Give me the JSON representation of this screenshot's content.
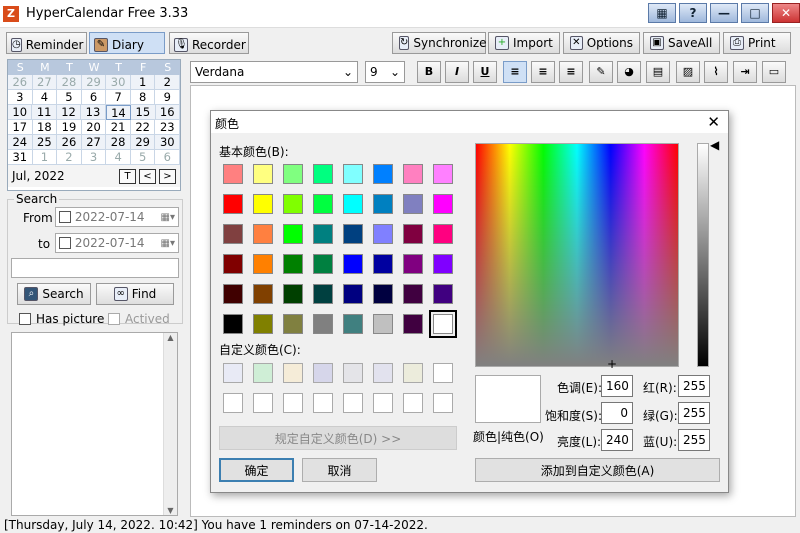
{
  "app": {
    "title": "HyperCalendar Free 3.33"
  },
  "tabs": [
    {
      "label": "Reminder"
    },
    {
      "label": "Diary"
    },
    {
      "label": "Recorder"
    }
  ],
  "toolbar": {
    "synchronize": "Synchronize",
    "import": "Import",
    "options": "Options",
    "saveall": "SaveAll",
    "print": "Print"
  },
  "calendar": {
    "weekdays": [
      "S",
      "M",
      "T",
      "W",
      "T",
      "F",
      "S"
    ],
    "weeks": [
      [
        "26",
        "27",
        "28",
        "29",
        "30",
        "1",
        "2"
      ],
      [
        "3",
        "4",
        "5",
        "6",
        "7",
        "8",
        "9"
      ],
      [
        "10",
        "11",
        "12",
        "13",
        "14",
        "15",
        "16"
      ],
      [
        "17",
        "18",
        "19",
        "20",
        "21",
        "22",
        "23"
      ],
      [
        "24",
        "25",
        "26",
        "27",
        "28",
        "29",
        "30"
      ],
      [
        "31",
        "1",
        "2",
        "3",
        "4",
        "5",
        "6"
      ]
    ],
    "selected": "14",
    "month_label": "Jul, 2022",
    "today_btn": "T",
    "prev": "<",
    "next": ">"
  },
  "search": {
    "group_label": "Search",
    "from_label": "From",
    "from_value": "2022-07-14",
    "to_label": "to",
    "to_value": "2022-07-14",
    "text_value": "",
    "search_btn": "Search",
    "find_btn": "Find",
    "has_picture": "Has picture",
    "actived": "Actived"
  },
  "editor": {
    "font": "Verdana",
    "size": "9"
  },
  "status": "[Thursday, July 14, 2022. 10:42] You have 1 reminders on 07-14-2022.",
  "dialog": {
    "title": "颜色",
    "basic_label": "基本颜色(B):",
    "custom_label": "自定义颜色(C):",
    "define_btn": "规定自定义颜色(D) >>",
    "ok": "确定",
    "cancel": "取消",
    "color_solid": "颜色|纯色(O)",
    "hue_label": "色调(E):",
    "hue": "160",
    "sat_label": "饱和度(S):",
    "sat": "0",
    "lum_label": "亮度(L):",
    "lum": "240",
    "red_label": "红(R):",
    "red": "255",
    "green_label": "绿(G):",
    "green": "255",
    "blue_label": "蓝(U):",
    "blue": "255",
    "add_btn": "添加到自定义颜色(A)",
    "basic_colors": [
      [
        "#ff8080",
        "#ffff80",
        "#80ff80",
        "#00ff80",
        "#80ffff",
        "#0080ff",
        "#ff80c0",
        "#ff80ff"
      ],
      [
        "#ff0000",
        "#ffff00",
        "#80ff00",
        "#00ff40",
        "#00ffff",
        "#0080c0",
        "#8080c0",
        "#ff00ff"
      ],
      [
        "#804040",
        "#ff8040",
        "#00ff00",
        "#008080",
        "#004080",
        "#8080ff",
        "#800040",
        "#ff0080"
      ],
      [
        "#800000",
        "#ff8000",
        "#008000",
        "#008040",
        "#0000ff",
        "#0000a0",
        "#800080",
        "#8000ff"
      ],
      [
        "#400000",
        "#804000",
        "#004000",
        "#004040",
        "#000080",
        "#000040",
        "#400040",
        "#400080"
      ],
      [
        "#000000",
        "#808000",
        "#808040",
        "#808080",
        "#408080",
        "#c0c0c0",
        "#400040",
        "#ffffff"
      ]
    ],
    "custom_colors": [
      [
        "#e8eaf5",
        "#cfeed6",
        "#f5ecd8",
        "#d6d6ea",
        "#e4e4e8",
        "#e2e2ee",
        "#ececdc",
        "#ffffff"
      ],
      [
        "#ffffff",
        "#ffffff",
        "#ffffff",
        "#ffffff",
        "#ffffff",
        "#ffffff",
        "#ffffff",
        "#ffffff"
      ]
    ]
  }
}
